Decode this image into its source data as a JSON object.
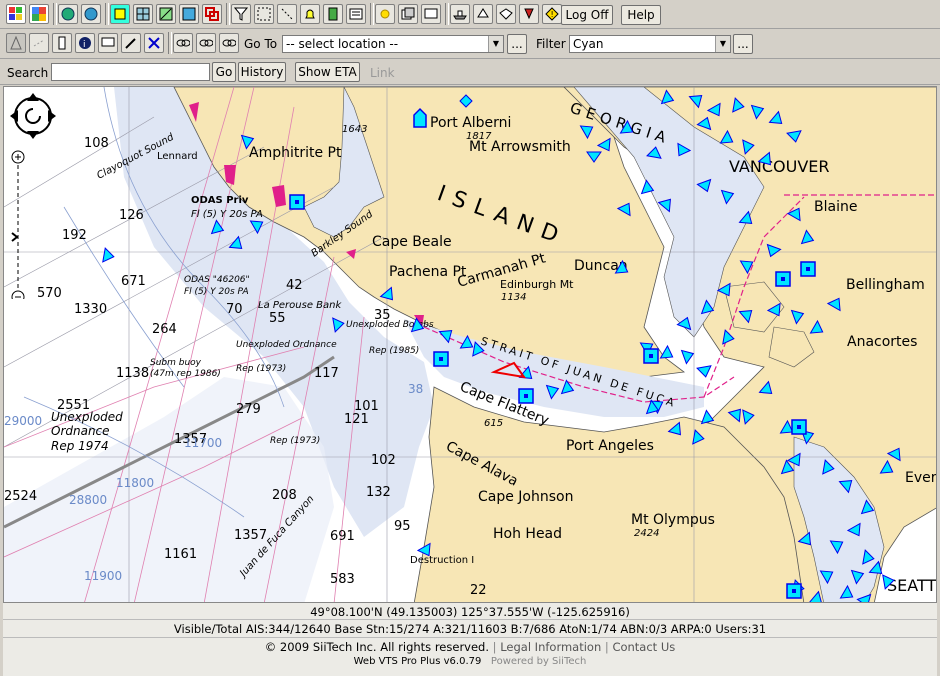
{
  "toolbar": {
    "logoff_label": "Log Off",
    "help_label": "Help",
    "goto_label": "Go To",
    "goto_value": "-- select location --",
    "filter_label": "Filter",
    "filter_value": "Cyan",
    "more_label": "..."
  },
  "search": {
    "label": "Search",
    "value": "",
    "go_label": "Go",
    "history_label": "History",
    "show_eta_label": "Show ETA",
    "link_label": "Link"
  },
  "map": {
    "places": {
      "port_alberni": "Port Alberni",
      "mt_arrowsmith": "Mt Arrowsmith",
      "amphitrite": "Amphitrite Pt",
      "lennard": "Lennard",
      "clayoquot": "Clayoquot Sound",
      "georgia": "GEORGIA",
      "vancouver": "VANCOUVER",
      "blaine": "Blaine",
      "bellingham": "Bellingham",
      "anacortes": "Anacortes",
      "island": "ISLAND",
      "cape_beale": "Cape Beale",
      "barkley": "Barkley Sound",
      "pachena": "Pachena Pt",
      "carmanah": "Carmanah Pt",
      "duncan": "Duncan",
      "edinburgh": "Edinburgh Mt",
      "strait": "STRAIT OF JUAN DE FUCA",
      "cape_flattery": "Cape Flattery",
      "port_angeles": "Port Angeles",
      "cape_alava": "Cape Alava",
      "cape_johnson": "Cape Johnson",
      "hoh_head": "Hoh Head",
      "mt_olympus": "Mt Olympus",
      "everett": "Ever",
      "seattle": "SEATT",
      "la_perouse": "La Perouse Bank",
      "juan_de_fuca_canyon": "Juan de Fuca Canyon",
      "destruction": "Destruction I",
      "odas1": "ODAS Priv",
      "odas1b": "Fl (5) Y 20s PA",
      "odas2": "ODAS \"46206\"",
      "odas2b": "Fl (5) Y 20s PA",
      "ordnance1": "Unexploded",
      "ordnance1b": "Ordnance",
      "ordnance1c": "Rep 1974",
      "ordnance2": "Unexploded Ordnance",
      "ordnance2b": "Rep (1973)",
      "subm_buoy": "Subm buoy",
      "subm_buoy2": "(47m rep 1986)",
      "bombs": "Unexploded Bombs",
      "rep1985": "Rep (1985)",
      "rep1973b": "Rep (1973)"
    },
    "depths": [
      "108",
      "126",
      "192",
      "671",
      "570",
      "1330",
      "264",
      "1138",
      "2551",
      "1357",
      "70",
      "55",
      "42",
      "35",
      "121",
      "101",
      "102",
      "132",
      "208",
      "1161",
      "691",
      "583",
      "95",
      "22",
      "2524",
      "1357",
      "38",
      "28800",
      "29000",
      "11700",
      "11800",
      "11900",
      "1643",
      "1817",
      "1134",
      "615",
      "2424",
      "279",
      "117"
    ]
  },
  "status": {
    "coords": "49°08.100'N (49.135003)   125°37.555'W (-125.625916)",
    "stats": "Visible/Total AIS:344/12640  Base Stn:15/274  A:321/11603  B:7/686  AtoN:1/74  ABN:0/3  ARPA:0  Users:31",
    "copyright": "© 2009 SiiTech Inc. All rights reserved.",
    "legal": "Legal Information",
    "contact": "Contact Us",
    "version": "Web VTS Pro Plus v6.0.79",
    "powered": "Powered by SiiTech"
  },
  "colors": {
    "land": "#f7e6b5",
    "water": "#ffffff",
    "shallow": "#c8d4ec",
    "vessel": "#00e5ff",
    "vessel_stroke": "#0000ee",
    "highlight": "#ee0000",
    "traffic_lane": "#e0208a"
  }
}
